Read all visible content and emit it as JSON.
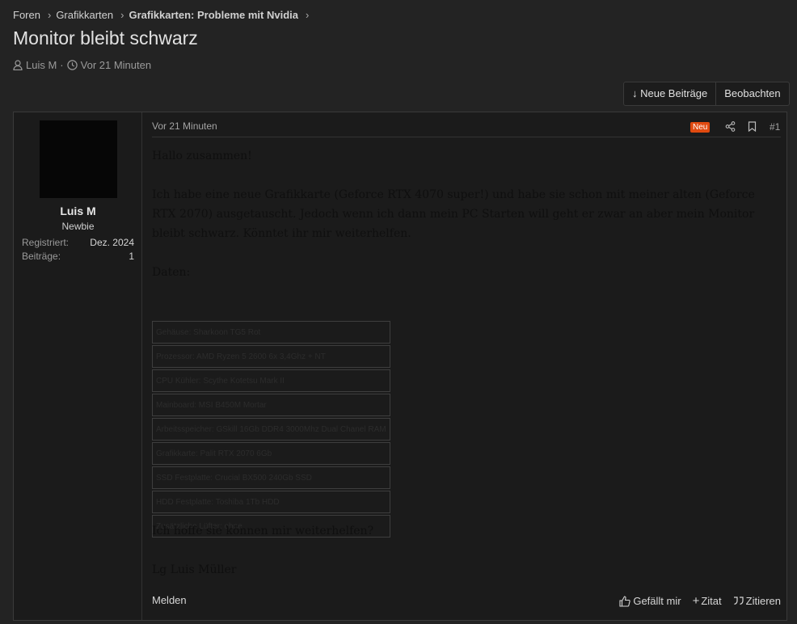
{
  "breadcrumb": [
    {
      "label": "Foren"
    },
    {
      "label": "Grafikkarten"
    },
    {
      "label": "Grafikkarten: Probleme mit Nvidia"
    }
  ],
  "thread": {
    "title": "Monitor bleibt schwarz",
    "author": "Luis M",
    "time": "Vor 21 Minuten"
  },
  "buttons": {
    "new_posts": "↓ Neue Beiträge",
    "watch": "Beobachten"
  },
  "user": {
    "name": "Luis M",
    "rank": "Newbie",
    "registered_label": "Registriert:",
    "registered_value": "Dez. 2024",
    "posts_label": "Beiträge:",
    "posts_value": "1"
  },
  "post": {
    "date": "Vor 21 Minuten",
    "badge": "Neu",
    "number": "#1",
    "greeting": "Hallo zusammen!",
    "body": "Ich habe eine neue Grafikkarte (Geforce RTX 4070 super!) und habe sie schon mit meiner alten (Geforce RTX 2070) ausgetauscht. Jedoch wenn ich dann mein PC Starten will geht er zwar an aber mein Monitor bleibt schwarz. Könntet ihr mir weiterhelfen.",
    "data_label": "Daten:",
    "specs": [
      "Gehäuse: Sharkoon TG5 Rot",
      "Prozessor: AMD Ryzen 5 2600 6x 3,4Ghz + NT",
      "CPU Kühler: Scythe Kotetsu Mark II",
      "Mainboard: MSI B450M Mortar",
      "Arbeitsspeicher: GSkill 16Gb DDR4 3000Mhz Dual Chanel RAM",
      "Grafikkarte: Palit RTX 2070 6Gb",
      "SSD Festplatte: Crucial BX500 240Gb SSD",
      "HDD Festplatte: Toshiba 1Tb HDD",
      "Zusätzliche Lüfter: ohne"
    ],
    "closing": "Ich hoffe sie können mir weiterhelfen?",
    "signoff": "Lg Luis Müller"
  },
  "footer": {
    "report": "Melden",
    "like": "Gefällt mir",
    "quote_add": "Zitat",
    "quote": "Zitieren"
  }
}
